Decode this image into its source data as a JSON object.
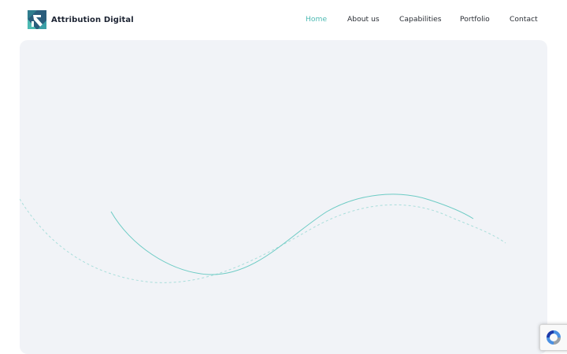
{
  "brand": {
    "name": "Attribution Digital",
    "logo_icon": "attribution-digital-logo-icon",
    "colors": {
      "primary": "#2a5d7c",
      "accent": "#4dbab3"
    }
  },
  "nav": {
    "items": [
      {
        "label": "Home",
        "active": true
      },
      {
        "label": "About us",
        "active": false
      },
      {
        "label": "Capabilities",
        "active": false
      },
      {
        "label": "Portfolio",
        "active": false
      },
      {
        "label": "Contact",
        "active": false
      }
    ],
    "active_color": "#4dbab3",
    "text_color": "#2b2f36"
  },
  "hero": {
    "background": "#f1f3f7",
    "decoration": "wave-lines",
    "solid_wave_color": "#6ccbc4",
    "dashed_wave_color": "#a9dedb"
  },
  "recaptcha_badge": {
    "icon": "recaptcha-icon"
  }
}
